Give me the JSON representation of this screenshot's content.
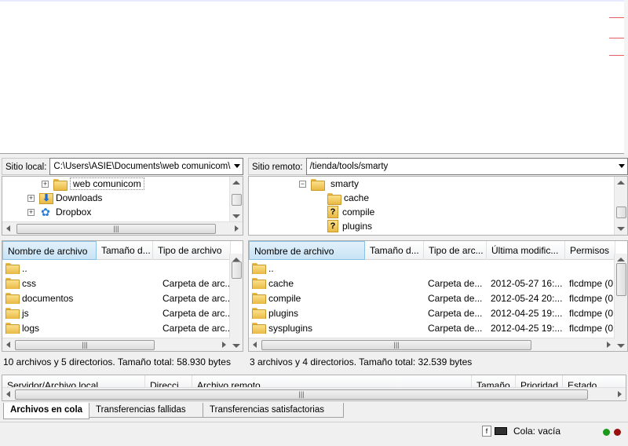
{
  "local": {
    "path_label": "Sitio local:",
    "path_value": "C:\\Users\\ASIE\\Documents\\web comunicom\\",
    "tree": [
      {
        "label": "web comunicom",
        "icon": "folder-icon"
      },
      {
        "label": "Downloads",
        "icon": "download-folder-icon"
      },
      {
        "label": "Dropbox",
        "icon": "dropbox-icon"
      }
    ],
    "columns": [
      "Nombre de archivo",
      "Tamaño d...",
      "Tipo de archivo"
    ],
    "rows": [
      {
        "name": "..",
        "type": ""
      },
      {
        "name": "css",
        "type": "Carpeta de arc..."
      },
      {
        "name": "documentos",
        "type": "Carpeta de arc..."
      },
      {
        "name": "js",
        "type": "Carpeta de arc..."
      },
      {
        "name": "logs",
        "type": "Carpeta de arc..."
      }
    ],
    "status": "10 archivos y 5 directorios. Tamaño total: 58.930 bytes"
  },
  "remote": {
    "path_label": "Sitio remoto:",
    "path_value": "/tienda/tools/smarty",
    "tree": [
      {
        "label": "smarty",
        "icon": "folder-icon"
      },
      {
        "label": "cache",
        "icon": "folder-icon"
      },
      {
        "label": "compile",
        "icon": "question-folder-icon"
      },
      {
        "label": "plugins",
        "icon": "question-folder-icon"
      }
    ],
    "columns": [
      "Nombre de archivo",
      "Tamaño d...",
      "Tipo de arc...",
      "Última modific...",
      "Permisos"
    ],
    "rows": [
      {
        "name": "..",
        "type": "",
        "modified": "",
        "perms": ""
      },
      {
        "name": "cache",
        "type": "Carpeta de...",
        "modified": "2012-05-27 16:...",
        "perms": "flcdmpe (0"
      },
      {
        "name": "compile",
        "type": "Carpeta de...",
        "modified": "2012-05-24 20:...",
        "perms": "flcdmpe (0"
      },
      {
        "name": "plugins",
        "type": "Carpeta de...",
        "modified": "2012-04-25 19:...",
        "perms": "flcdmpe (0"
      },
      {
        "name": "sysplugins",
        "type": "Carpeta de...",
        "modified": "2012-04-25 19:...",
        "perms": "flcdmpe (0"
      }
    ],
    "status": "3 archivos y 4 directorios. Tamaño total: 32.539 bytes"
  },
  "queue": {
    "columns": [
      "Servidor/Archivo local",
      "Direcci...",
      "Archivo remoto",
      "Tamaño",
      "Prioridad",
      "Estado"
    ]
  },
  "tabs": [
    "Archivos en cola",
    "Transferencias fallidas",
    "Transferencias satisfactorias"
  ],
  "statusbar": {
    "queue_text": "Cola: vacía",
    "led_colors": [
      "#1a9a1a",
      "#9a1010"
    ]
  }
}
